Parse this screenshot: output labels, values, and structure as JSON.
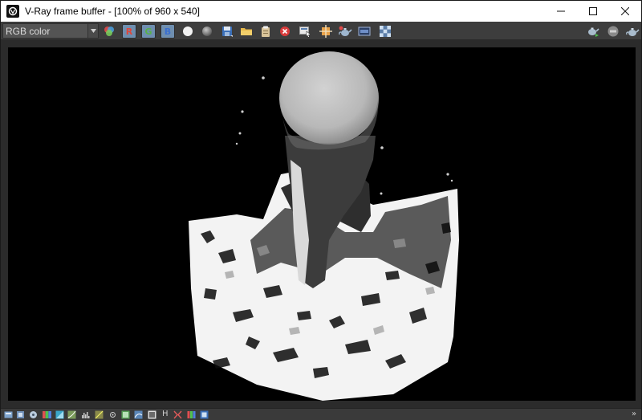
{
  "window": {
    "title": "V-Ray frame buffer - [100% of 960 x 540]",
    "controls": {
      "minimize": "—",
      "maximize": "☐",
      "close": "✕"
    }
  },
  "toolbar": {
    "channel": {
      "selected": "RGB color"
    },
    "rgb_buttons": {
      "r": "R",
      "g": "G",
      "b": "B"
    },
    "colors": {
      "r": "#6f8fb0",
      "g": "#6f8fb0",
      "b": "#6f8fb0",
      "r_text": "#e0473c",
      "g_text": "#58b04a",
      "b_text": "#3a6fd0"
    }
  },
  "statusbar": {
    "letter_h": "H",
    "expand_glyph": "»"
  },
  "viewport": {
    "background": "#000000"
  }
}
